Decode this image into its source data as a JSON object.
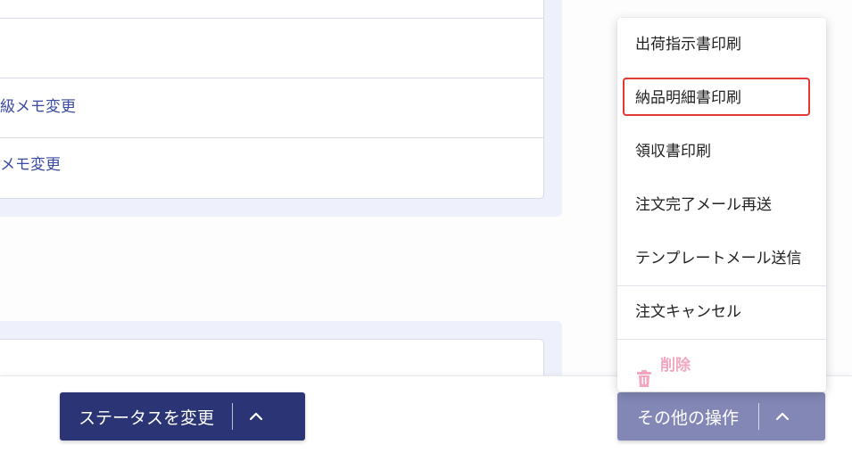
{
  "info_panel": {
    "rows": [
      {
        "label": ""
      },
      {
        "label": "級メモ変更"
      },
      {
        "label": "メモ変更"
      }
    ]
  },
  "action_bar": {
    "status_button_label": "ステータスを変更",
    "other_button_label": "その他の操作"
  },
  "menu": {
    "items": [
      {
        "label": "出荷指示書印刷"
      },
      {
        "label": "納品明細書印刷"
      },
      {
        "label": "領収書印刷"
      },
      {
        "label": "注文完了メール再送"
      },
      {
        "label": "テンプレートメール送信"
      },
      {
        "label": "注文キャンセル"
      },
      {
        "label": "削除"
      }
    ]
  },
  "colors": {
    "primary": "#2b3576",
    "primary_muted": "#8287b6",
    "link": "#3b4aa3",
    "danger_muted": "#f3a6bd",
    "highlight": "#e53935"
  },
  "icons": {
    "caret": "chevron-up-icon",
    "delete": "trash-icon"
  }
}
